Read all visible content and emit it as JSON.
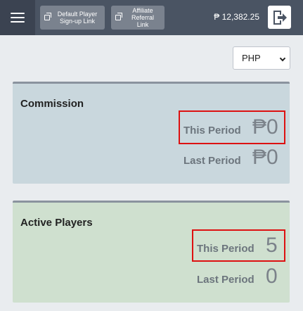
{
  "header": {
    "default_link_label": "Default Player Sign-up Link",
    "affiliate_link_label": "Affiliate Referral Link",
    "balance": "₱ 12,382.25"
  },
  "currency_select": {
    "selected": "PHP"
  },
  "commission": {
    "title": "Commission",
    "this_period_label": "This Period",
    "this_period_value": "₱0",
    "last_period_label": "Last Period",
    "last_period_value": "₱0"
  },
  "active_players": {
    "title": "Active Players",
    "this_period_label": "This Period",
    "this_period_value": "5",
    "last_period_label": "Last Period",
    "last_period_value": "0"
  },
  "icons": [
    "menu-icon",
    "link-icon",
    "logout-icon",
    "chevron-down-icon"
  ],
  "colors": {
    "topbar": "#4a5463",
    "highlight": "#dd1111",
    "commission_card": "#c9d7dd",
    "players_card": "#cfe0cf"
  }
}
